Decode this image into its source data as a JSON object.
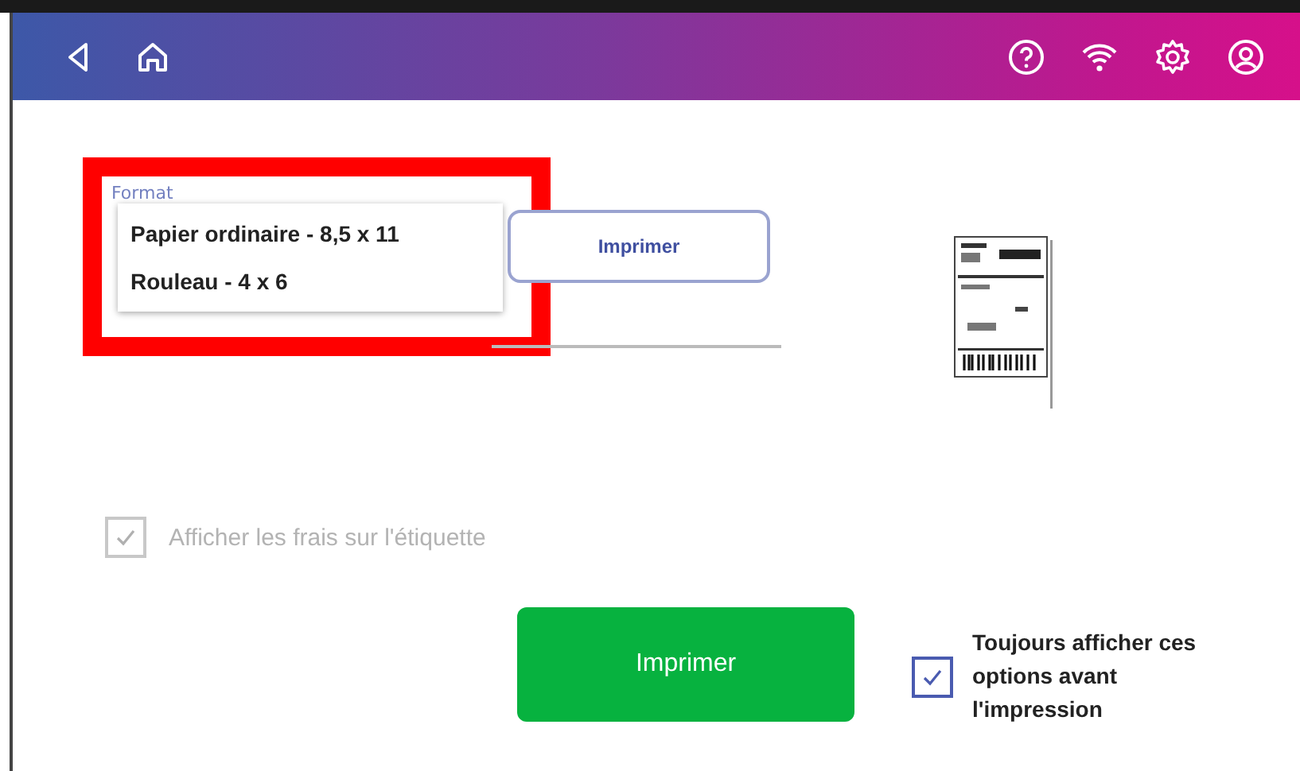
{
  "format": {
    "label": "Format",
    "options": [
      {
        "label": "Papier ordinaire - 8,5 x 11"
      },
      {
        "label": "Rouleau - 4 x 6"
      }
    ]
  },
  "secondary_button": "Imprimer",
  "show_fees": {
    "label": "Afficher les frais sur l'étiquette",
    "checked": true,
    "disabled": true
  },
  "print_button": "Imprimer",
  "always_show": {
    "label": "Toujours afficher ces options avant l'impression",
    "checked": true,
    "disabled": false
  }
}
